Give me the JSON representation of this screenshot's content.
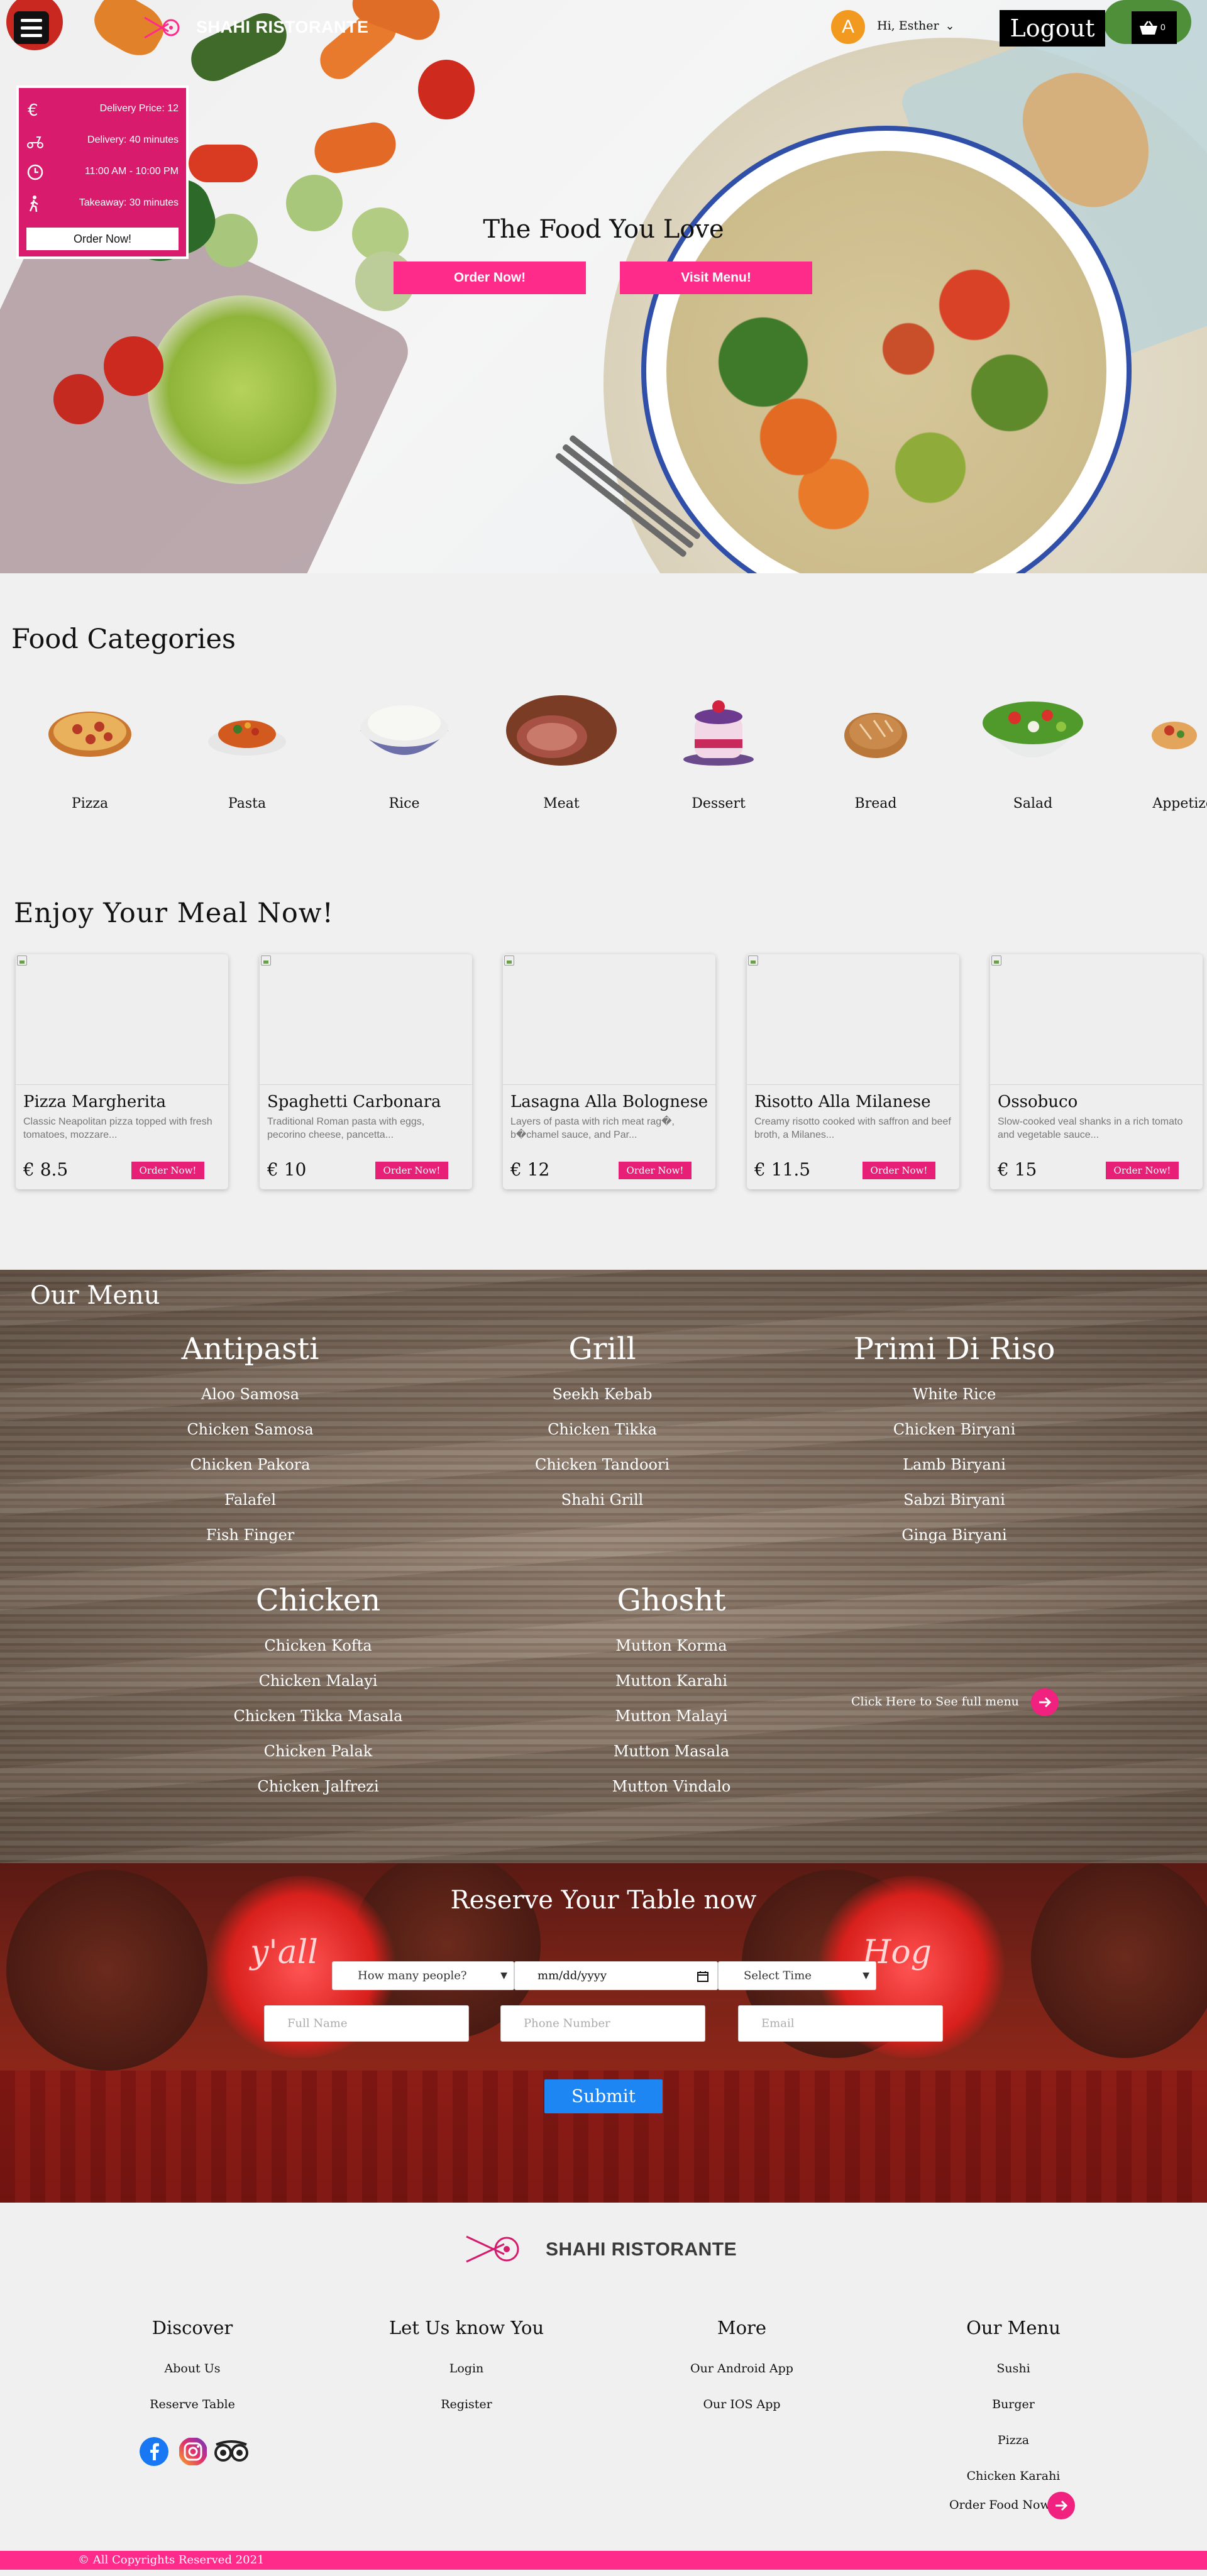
{
  "header": {
    "brand": "SHAHI RISTORANTE",
    "avatar_letter": "A",
    "greeting": "Hi, Esther",
    "logout_label": "Logout",
    "cart_count": "0"
  },
  "info": {
    "items": [
      {
        "text": "Delivery Price: 12",
        "icon": "euro-icon"
      },
      {
        "text": "Delivery: 40 minutes",
        "icon": "scooter-icon"
      },
      {
        "text": "11:00 AM - 10:00 PM",
        "icon": "clock-icon"
      },
      {
        "text": "Takeaway: 30 minutes",
        "icon": "walking-icon"
      }
    ],
    "order_label": "Order Now!"
  },
  "hero": {
    "title": "The Food You Love",
    "order_label": "Order Now!",
    "menu_label": "Visit Menu!"
  },
  "categories": {
    "title": "Food Categories",
    "items": [
      "Pizza",
      "Pasta",
      "Rice",
      "Meat",
      "Dessert",
      "Bread",
      "Salad",
      "Appetizers"
    ]
  },
  "meals": {
    "title": "Enjoy Your Meal Now!",
    "order_label": "Order Now!",
    "items": [
      {
        "name": "Pizza Margherita",
        "desc": "Classic Neapolitan pizza topped with fresh tomatoes, mozzare...",
        "price": "€ 8.5"
      },
      {
        "name": "Spaghetti Carbonara",
        "desc": "Traditional Roman pasta with eggs, pecorino cheese, pancetta...",
        "price": "€ 10"
      },
      {
        "name": "Lasagna Alla Bolognese",
        "desc": "Layers of pasta with rich meat rag�, b�chamel sauce, and Par...",
        "price": "€ 12"
      },
      {
        "name": "Risotto Alla Milanese",
        "desc": "Creamy risotto cooked with saffron and beef broth, a Milanes...",
        "price": "€ 11.5"
      },
      {
        "name": "Ossobuco",
        "desc": "Slow-cooked veal shanks in a rich tomato and vegetable sauce...",
        "price": "€ 15"
      }
    ]
  },
  "menu": {
    "title": "Our Menu",
    "columns": [
      {
        "heading": "Antipasti",
        "items": [
          "Aloo Samosa",
          "Chicken Samosa",
          "Chicken Pakora",
          "Falafel",
          "Fish Finger"
        ]
      },
      {
        "heading": "Grill",
        "items": [
          "Seekh Kebab",
          "Chicken Tikka",
          "Chicken Tandoori",
          "Shahi Grill"
        ]
      },
      {
        "heading": "Primi Di Riso",
        "items": [
          "White Rice",
          "Chicken Biryani",
          "Lamb Biryani",
          "Sabzi Biryani",
          "Ginga Biryani"
        ]
      },
      {
        "heading": "Chicken",
        "items": [
          "Chicken Kofta",
          "Chicken Malayi",
          "Chicken Tikka Masala",
          "Chicken Palak",
          "Chicken Jalfrezi"
        ]
      },
      {
        "heading": "Ghosht",
        "items": [
          "Mutton Korma",
          "Mutton Karahi",
          "Mutton Malayi",
          "Mutton Masala",
          "Mutton Vindalo"
        ]
      }
    ],
    "full_menu_label": "Click Here to See full menu"
  },
  "reserve": {
    "title": "Reserve Your Table now",
    "sign_1": "y'all",
    "sign_2": "Hog",
    "people_placeholder": "How many people?",
    "date_placeholder": "mm/dd/yyyy",
    "time_placeholder": "Select Time",
    "name_placeholder": "Full Name",
    "phone_placeholder": "Phone Number",
    "email_placeholder": "Email",
    "submit_label": "Submit"
  },
  "footer": {
    "brand": "SHAHI RISTORANTE",
    "columns": [
      {
        "heading": "Discover",
        "items": [
          "About Us",
          "Reserve Table"
        ]
      },
      {
        "heading": "Let Us know You",
        "items": [
          "Login",
          "Register"
        ]
      },
      {
        "heading": "More",
        "items": [
          "Our Android App",
          "Our IOS App"
        ]
      },
      {
        "heading": "Our Menu",
        "items": [
          "Sushi",
          "Burger",
          "Pizza",
          "Chicken Karahi"
        ]
      }
    ],
    "order_food_label": "Order Food Now!",
    "copyright": "©  All Copyrights Reserved 2021"
  },
  "colors": {
    "accent_pink": "#ff2b8a",
    "info_magenta": "#d81b6d",
    "submit_blue": "#1d86f2"
  }
}
